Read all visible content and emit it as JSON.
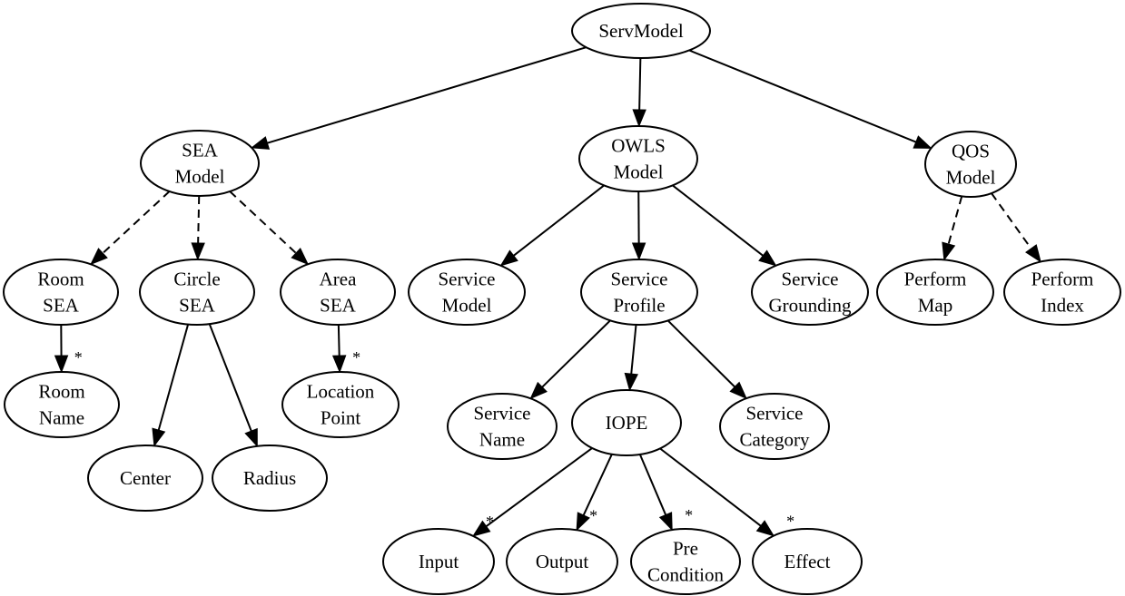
{
  "diagram": {
    "title": "ServModel",
    "colors": {
      "stroke": "#000000",
      "fill": "#ffffff",
      "background": "#ffffff"
    },
    "nodes": [
      {
        "id": "servmodel",
        "lines": [
          "ServModel"
        ]
      },
      {
        "id": "sea-model",
        "lines": [
          "SEA",
          "Model"
        ]
      },
      {
        "id": "owls-model",
        "lines": [
          "OWLS",
          "Model"
        ]
      },
      {
        "id": "qos-model",
        "lines": [
          "QOS",
          "Model"
        ]
      },
      {
        "id": "room-sea",
        "lines": [
          "Room",
          "SEA"
        ]
      },
      {
        "id": "circle-sea",
        "lines": [
          "Circle",
          "SEA"
        ]
      },
      {
        "id": "area-sea",
        "lines": [
          "Area",
          "SEA"
        ]
      },
      {
        "id": "room-name",
        "lines": [
          "Room",
          "Name"
        ]
      },
      {
        "id": "center",
        "lines": [
          "Center"
        ]
      },
      {
        "id": "radius",
        "lines": [
          "Radius"
        ]
      },
      {
        "id": "location-point",
        "lines": [
          "Location",
          "Point"
        ]
      },
      {
        "id": "service-model",
        "lines": [
          "Service",
          "Model"
        ]
      },
      {
        "id": "service-profile",
        "lines": [
          "Service",
          "Profile"
        ]
      },
      {
        "id": "service-grounding",
        "lines": [
          "Service",
          "Grounding"
        ]
      },
      {
        "id": "perform-map",
        "lines": [
          "Perform",
          "Map"
        ]
      },
      {
        "id": "perform-index",
        "lines": [
          "Perform",
          "Index"
        ]
      },
      {
        "id": "service-name",
        "lines": [
          "Service",
          "Name"
        ]
      },
      {
        "id": "iope",
        "lines": [
          "IOPE"
        ]
      },
      {
        "id": "service-category",
        "lines": [
          "Service",
          "Category"
        ]
      },
      {
        "id": "input",
        "lines": [
          "Input"
        ]
      },
      {
        "id": "output",
        "lines": [
          "Output"
        ]
      },
      {
        "id": "pre-condition",
        "lines": [
          "Pre",
          "Condition"
        ]
      },
      {
        "id": "effect",
        "lines": [
          "Effect"
        ]
      }
    ],
    "edges": [
      {
        "from": "servmodel",
        "to": "sea-model",
        "style": "solid",
        "multiplicity": ""
      },
      {
        "from": "servmodel",
        "to": "owls-model",
        "style": "solid",
        "multiplicity": ""
      },
      {
        "from": "servmodel",
        "to": "qos-model",
        "style": "solid",
        "multiplicity": ""
      },
      {
        "from": "sea-model",
        "to": "room-sea",
        "style": "dashed",
        "multiplicity": ""
      },
      {
        "from": "sea-model",
        "to": "circle-sea",
        "style": "dashed",
        "multiplicity": ""
      },
      {
        "from": "sea-model",
        "to": "area-sea",
        "style": "dashed",
        "multiplicity": ""
      },
      {
        "from": "room-sea",
        "to": "room-name",
        "style": "solid",
        "multiplicity": "*"
      },
      {
        "from": "circle-sea",
        "to": "center",
        "style": "solid",
        "multiplicity": ""
      },
      {
        "from": "circle-sea",
        "to": "radius",
        "style": "solid",
        "multiplicity": ""
      },
      {
        "from": "area-sea",
        "to": "location-point",
        "style": "solid",
        "multiplicity": "*"
      },
      {
        "from": "owls-model",
        "to": "service-model",
        "style": "solid",
        "multiplicity": ""
      },
      {
        "from": "owls-model",
        "to": "service-profile",
        "style": "solid",
        "multiplicity": ""
      },
      {
        "from": "owls-model",
        "to": "service-grounding",
        "style": "solid",
        "multiplicity": ""
      },
      {
        "from": "qos-model",
        "to": "perform-map",
        "style": "dashed",
        "multiplicity": ""
      },
      {
        "from": "qos-model",
        "to": "perform-index",
        "style": "dashed",
        "multiplicity": ""
      },
      {
        "from": "service-profile",
        "to": "service-name",
        "style": "solid",
        "multiplicity": ""
      },
      {
        "from": "service-profile",
        "to": "iope",
        "style": "solid",
        "multiplicity": ""
      },
      {
        "from": "service-profile",
        "to": "service-category",
        "style": "solid",
        "multiplicity": ""
      },
      {
        "from": "iope",
        "to": "input",
        "style": "solid",
        "multiplicity": "*"
      },
      {
        "from": "iope",
        "to": "output",
        "style": "solid",
        "multiplicity": "*"
      },
      {
        "from": "iope",
        "to": "pre-condition",
        "style": "solid",
        "multiplicity": "*"
      },
      {
        "from": "iope",
        "to": "effect",
        "style": "solid",
        "multiplicity": "*"
      }
    ]
  }
}
